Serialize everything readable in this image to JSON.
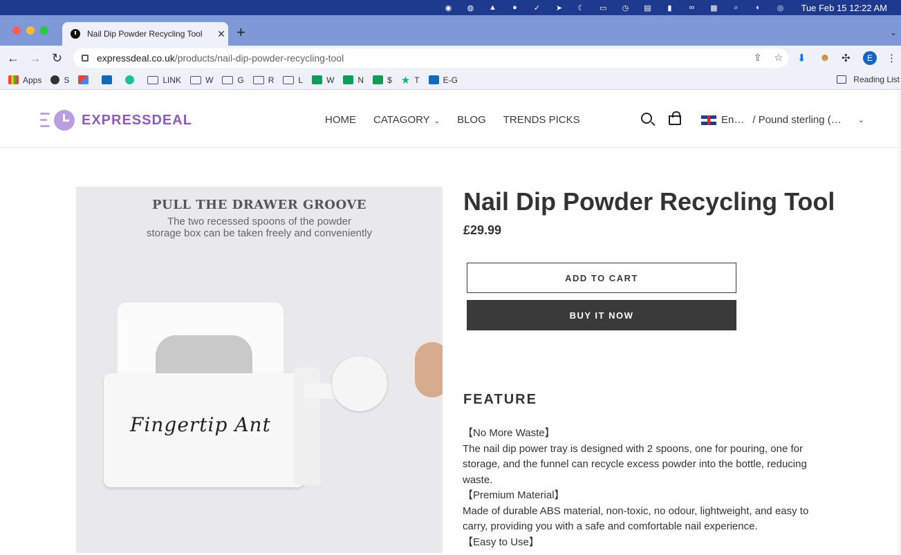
{
  "system_menubar": {
    "clock": "Tue Feb 15  12:22 AM",
    "icons": [
      "line-icon",
      "wechat-icon",
      "notification-icon",
      "messenger-icon",
      "checkmark-app-icon",
      "send-icon",
      "moon-icon",
      "screen-icon",
      "time-machine-icon",
      "us-flag-icon",
      "battery-icon",
      "link-icon",
      "keyboard-icon",
      "spotlight-icon",
      "control-center-icon",
      "siri-icon"
    ]
  },
  "browser": {
    "tab_title": "Nail Dip Powder Recycling Tool",
    "url_host": "expressdeal.co.uk",
    "url_path": "/products/nail-dip-powder-recycling-tool",
    "profile_initial": "E",
    "bookmarks": [
      {
        "label": "Apps",
        "icon": "apps-grid-icon"
      },
      {
        "label": "S",
        "icon": "globe-icon"
      },
      {
        "label": "",
        "icon": "gmail-icon"
      },
      {
        "label": "",
        "icon": "outlook-icon"
      },
      {
        "label": "",
        "icon": "grammarly-icon"
      },
      {
        "label": "LINK",
        "icon": "folder-icon"
      },
      {
        "label": "W",
        "icon": "folder-icon"
      },
      {
        "label": "G",
        "icon": "folder-icon"
      },
      {
        "label": "R",
        "icon": "folder-icon"
      },
      {
        "label": "L",
        "icon": "folder-icon"
      },
      {
        "label": "W",
        "icon": "sheets-icon"
      },
      {
        "label": "N",
        "icon": "sheets-icon"
      },
      {
        "label": "$",
        "icon": "sheets-icon"
      },
      {
        "label": "T",
        "icon": "star-icon"
      },
      {
        "label": "E-G",
        "icon": "outlook-icon"
      }
    ],
    "reading_list": "Reading List"
  },
  "site": {
    "logo": "EXPRESSDEAL",
    "nav": {
      "home": "HOME",
      "catagory": "CATAGORY",
      "blog": "BLOG",
      "trends": "TRENDS PICKS"
    },
    "language": "En…",
    "currency": "/ Pound sterling (…"
  },
  "product": {
    "title": "Nail Dip Powder Recycling Tool",
    "price": "£29.99",
    "add_to_cart": "ADD TO CART",
    "buy_now": "BUY IT NOW",
    "image": {
      "headline": "PULL THE DRAWER GROOVE",
      "caption_line1": "The two recessed spoons of the powder",
      "caption_line2": "storage box can be taken freely and conveniently",
      "brand": "Fingertip Ant"
    },
    "feature_heading": "FEATURE",
    "features": [
      {
        "heading": "【No More Waste】",
        "text": "The nail dip power tray is designed with 2 spoons, one for pouring, one for storage, and the funnel can recycle excess powder into the bottle, reducing waste."
      },
      {
        "heading": "【Premium Material】",
        "text": "Made of durable ABS material, non-toxic, no odour, lightweight, and easy to carry, providing you with a safe and comfortable nail experience."
      },
      {
        "heading": "【Easy to Use】",
        "text": ""
      }
    ]
  }
}
